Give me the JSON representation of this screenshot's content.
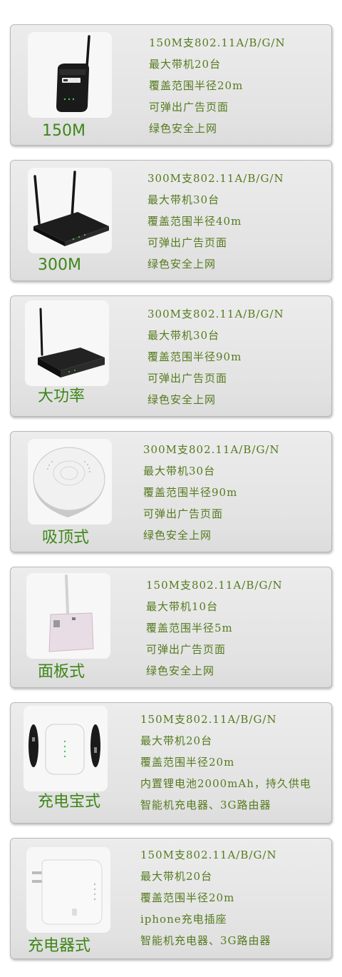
{
  "products": [
    {
      "name": "150M",
      "image": "router-single-antenna-icon",
      "specs": [
        "150M支802.11A/B/G/N",
        "最大带机20台",
        "覆盖范围半径20m",
        "可弹出广告页面",
        "绿色安全上网"
      ]
    },
    {
      "name": "300M",
      "image": "router-dual-antenna-icon",
      "specs": [
        "300M支802.11A/B/G/N",
        "最大带机30台",
        "覆盖范围半径40m",
        "可弹出广告页面",
        "绿色安全上网"
      ]
    },
    {
      "name": "大功率",
      "image": "router-high-power-icon",
      "specs": [
        "300M支802.11A/B/G/N",
        "最大带机30台",
        "覆盖范围半径90m",
        "可弹出广告页面",
        "绿色安全上网"
      ]
    },
    {
      "name": "吸顶式",
      "image": "ceiling-access-point-icon",
      "specs": [
        "300M支802.11A/B/G/N",
        "最大带机30台",
        "覆盖范围半径90m",
        "可弹出广告页面",
        "绿色安全上网"
      ]
    },
    {
      "name": "面板式",
      "image": "wall-panel-access-point-icon",
      "specs": [
        "150M支802.11A/B/G/N",
        "最大带机10台",
        "覆盖范围半径5m",
        "可弹出广告页面",
        "绿色安全上网"
      ]
    },
    {
      "name": "充电宝式",
      "image": "power-bank-router-icon",
      "specs": [
        "150M支802.11A/B/G/N",
        "最大带机20台",
        "覆盖范围半径20m",
        "内置锂电池2000mAh，持久供电",
        "智能机充电器、3G路由器"
      ]
    },
    {
      "name": "充电器式",
      "image": "charger-router-icon",
      "specs": [
        "150M支802.11A/B/G/N",
        "最大带机20台",
        "覆盖范围半径20m",
        "iphone充电插座",
        "智能机充电器、3G路由器"
      ]
    }
  ],
  "colors": {
    "name_green": "#3e8618",
    "spec_green": "#557a1e",
    "card_bg": "#e6e6e6",
    "card_border": "#b9b9b9"
  }
}
